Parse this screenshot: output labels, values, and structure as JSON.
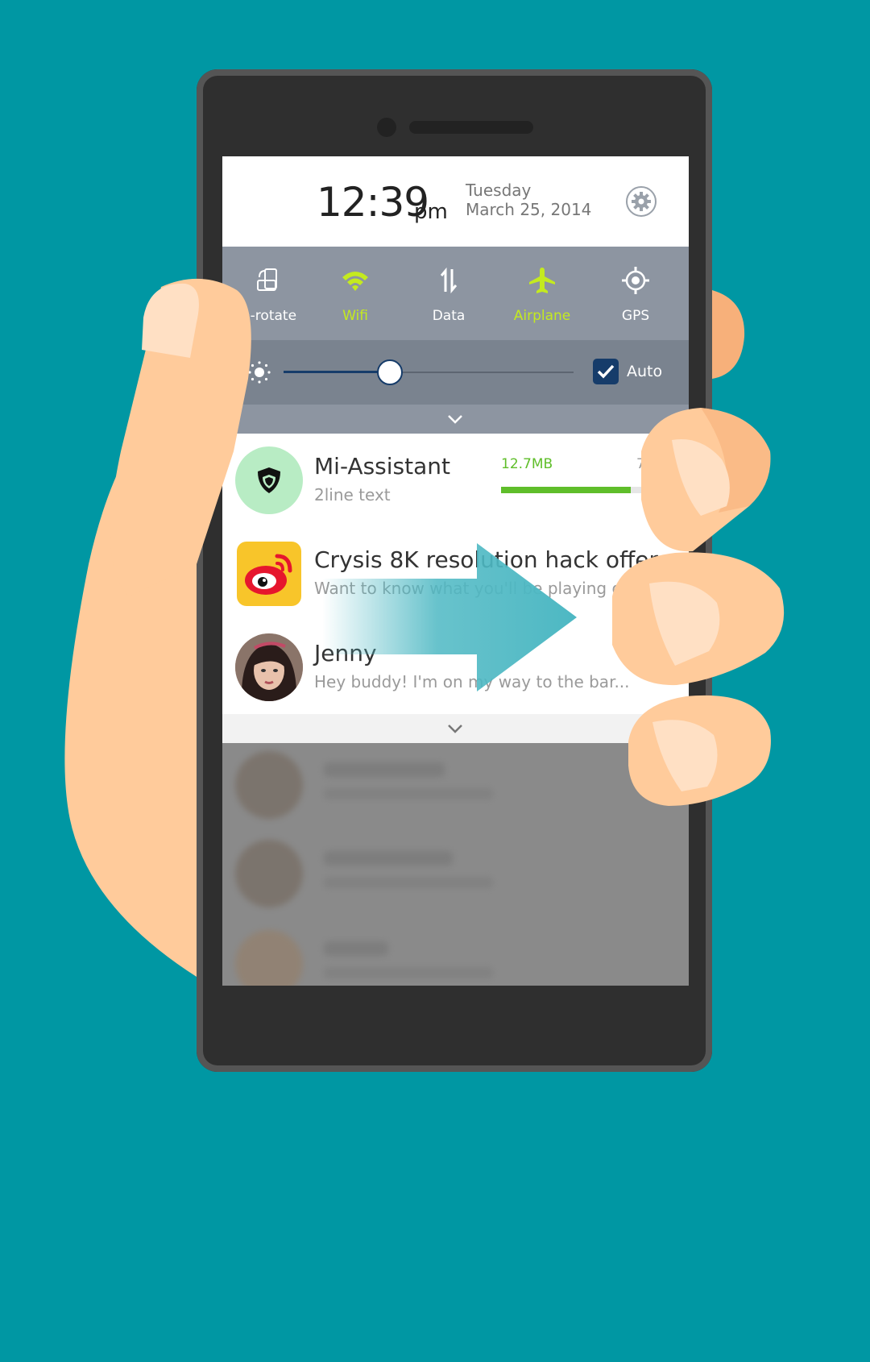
{
  "header": {
    "time": "12:39",
    "ampm": "pm",
    "day": "Tuesday",
    "date": "March 25, 2014"
  },
  "toggles": [
    {
      "label": "Auto-rotate",
      "visible_label": "o-rotate",
      "icon": "rotate-icon",
      "active": false
    },
    {
      "label": "Wifi",
      "icon": "wifi-icon",
      "active": true
    },
    {
      "label": "Data",
      "icon": "data-icon",
      "active": false
    },
    {
      "label": "Airplane",
      "icon": "airplane-icon",
      "active": true
    },
    {
      "label": "GPS",
      "icon": "gps-icon",
      "active": false
    }
  ],
  "brightness": {
    "level": 0.36,
    "auto_label": "Auto",
    "auto_checked": true
  },
  "notifications": [
    {
      "title": "Mi-Assistant",
      "subtitle": "2line text",
      "progress_label": "12.7MB",
      "progress_right": "7",
      "progress": 0.73,
      "icon": "shield-icon"
    },
    {
      "title": "Crysis 8K resolution hack offers...",
      "subtitle": "Want to know what you'll be playing on you",
      "icon": "weibo-icon"
    },
    {
      "title": "Jenny",
      "subtitle": "Hey buddy! I'm on my way to the bar...",
      "icon": "avatar"
    }
  ],
  "colors": {
    "background": "#0097a3",
    "accent_lime": "#c4ea1f",
    "progress_green": "#5fbe2a",
    "arrow": "#4db8c3",
    "checkbox": "#163c6a"
  }
}
